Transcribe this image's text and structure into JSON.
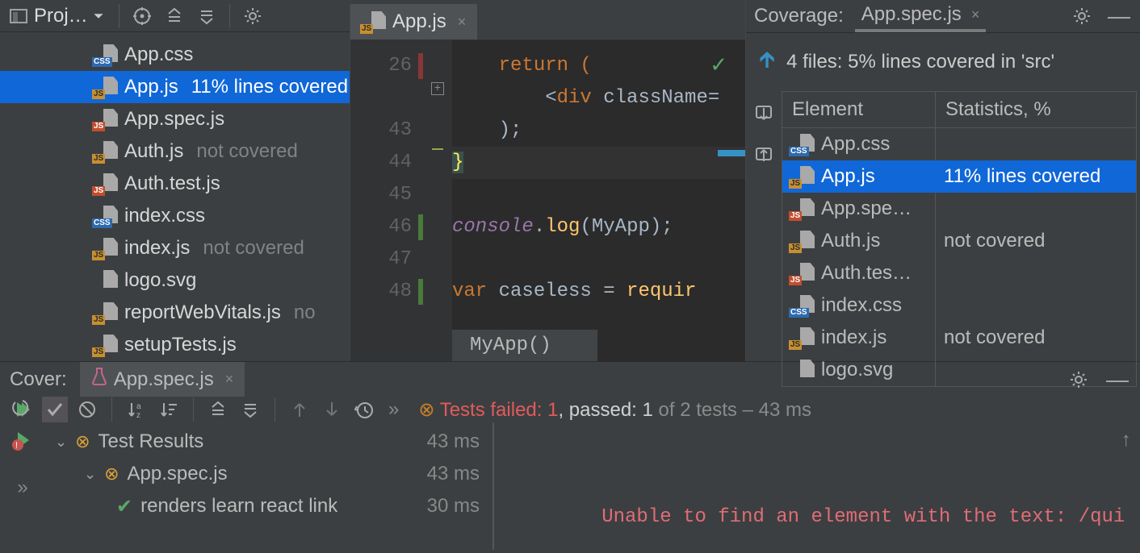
{
  "project": {
    "label": "Proj…",
    "tree": [
      {
        "icon": "css",
        "name": "App.css",
        "cov": ""
      },
      {
        "icon": "js",
        "name": "App.js",
        "cov": "11% lines covered",
        "selected": true
      },
      {
        "icon": "spec",
        "name": "App.spec.js",
        "cov": ""
      },
      {
        "icon": "js",
        "name": "Auth.js",
        "cov": "not covered"
      },
      {
        "icon": "spec",
        "name": "Auth.test.js",
        "cov": ""
      },
      {
        "icon": "css",
        "name": "index.css",
        "cov": ""
      },
      {
        "icon": "js",
        "name": "index.js",
        "cov": "not covered"
      },
      {
        "icon": "svg",
        "name": "logo.svg",
        "cov": ""
      },
      {
        "icon": "js",
        "name": "reportWebVitals.js",
        "cov": "no"
      },
      {
        "icon": "js",
        "name": "setupTests.js",
        "cov": ""
      }
    ]
  },
  "editor": {
    "tab_file": "App.js",
    "line_numbers": [
      "26",
      "",
      "43",
      "44",
      "45",
      "46",
      "47",
      "48"
    ],
    "lines": {
      "l26": "    return (",
      "l27": "        <div className=",
      "l43": "    );",
      "l44": "}",
      "l46_a": "console",
      "l46_b": ".",
      "l46_c": "log",
      "l46_d": "(MyApp);",
      "l48_a": "var ",
      "l48_b": "caseless = ",
      "l48_c": "requir"
    },
    "hint": "MyApp()"
  },
  "coverage": {
    "panel_title": "Coverage:",
    "tab": "App.spec.js",
    "summary": "4 files: 5% lines covered in 'src'",
    "headers": {
      "element": "Element",
      "stats": "Statistics, %"
    },
    "rows": [
      {
        "icon": "css",
        "name": "App.css",
        "stat": ""
      },
      {
        "icon": "js",
        "name": "App.js",
        "stat": "11% lines covered",
        "selected": true
      },
      {
        "icon": "spec",
        "name": "App.spe…",
        "stat": ""
      },
      {
        "icon": "js",
        "name": "Auth.js",
        "stat": "not covered"
      },
      {
        "icon": "spec",
        "name": "Auth.tes…",
        "stat": ""
      },
      {
        "icon": "css",
        "name": "index.css",
        "stat": ""
      },
      {
        "icon": "js",
        "name": "index.js",
        "stat": "not covered"
      },
      {
        "icon": "svg",
        "name": "logo.svg",
        "stat": ""
      }
    ]
  },
  "run": {
    "label": "Cover:",
    "tab": "App.spec.js",
    "summary": {
      "failed_label": "Tests failed: 1",
      "passed_label": ", passed: 1",
      "rest": " of 2 tests – 43 ms"
    },
    "tree": {
      "root": "Test Results",
      "root_dur": "43 ms",
      "suite": "App.spec.js",
      "suite_dur": "43 ms",
      "test1": "renders learn react link",
      "test1_dur": "30 ms"
    },
    "output": "  Unable to find an element with the text: /qui"
  }
}
